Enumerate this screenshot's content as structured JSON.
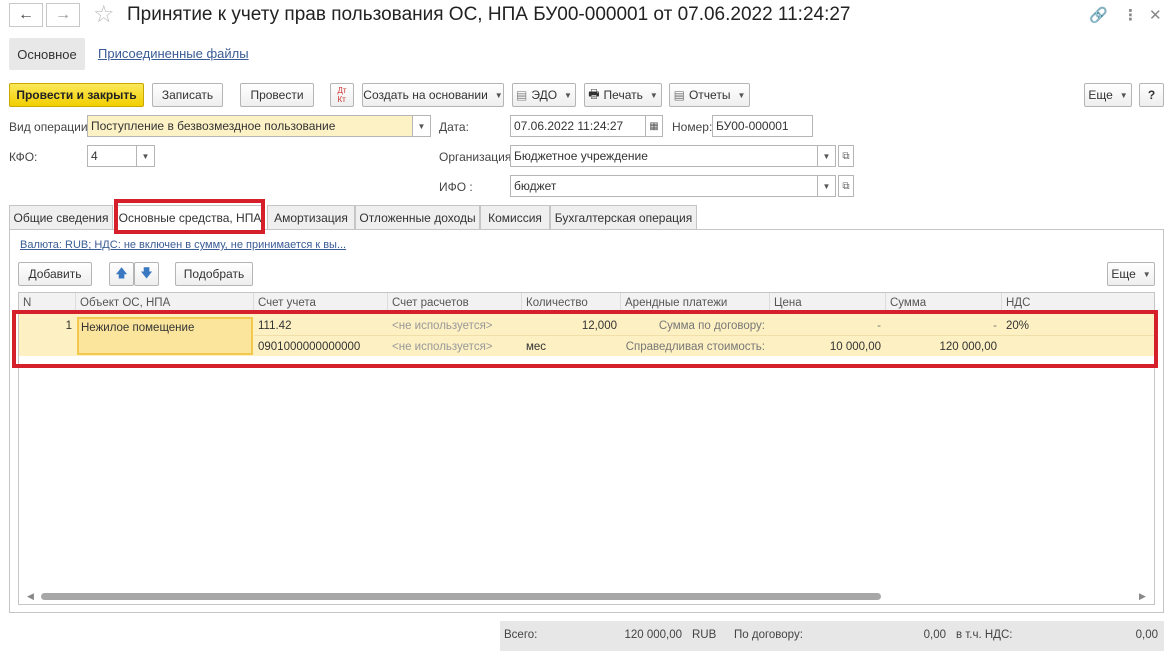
{
  "window": {
    "title": "Принятие к учету прав пользования ОС, НПА БУ00-000001 от 07.06.2022 11:24:27"
  },
  "nav": {
    "main": "Основное",
    "files": "Присоединенные файлы"
  },
  "toolbar": {
    "post_close": "Провести и закрыть",
    "save": "Записать",
    "post": "Провести",
    "create_based": "Создать на основании",
    "edo": "ЭДО",
    "print": "Печать",
    "reports": "Отчеты",
    "more": "Еще",
    "help": "?"
  },
  "form": {
    "operation_label": "Вид операции:",
    "operation_value": "Поступление в безвозмездное пользование",
    "date_label": "Дата:",
    "date_value": "07.06.2022 11:24:27",
    "number_label": "Номер:",
    "number_value": "БУ00-000001",
    "kfo_label": "КФО:",
    "kfo_value": "4",
    "org_label": "Организация:",
    "org_value": "Бюджетное учреждение",
    "ifo_label": "ИФО :",
    "ifo_value": "бюджет"
  },
  "tabs": [
    {
      "label": "Общие сведения"
    },
    {
      "label": "Основные средства, НПА"
    },
    {
      "label": "Амортизация"
    },
    {
      "label": "Отложенные доходы"
    },
    {
      "label": "Комиссия"
    },
    {
      "label": "Бухгалтерская операция"
    }
  ],
  "panel": {
    "currency_info": "Валюта: RUB; НДС: не включен в сумму, не принимается к вы...",
    "add": "Добавить",
    "select": "Подобрать",
    "more": "Еще"
  },
  "table": {
    "columns": [
      "N",
      "Объект ОС, НПА",
      "Счет учета",
      "Счет расчетов",
      "Количество",
      "Арендные платежи",
      "Цена",
      "Сумма",
      "НДС"
    ],
    "row": {
      "n": "1",
      "object": "Нежилое помещение",
      "account": "111.42",
      "account2": "0901000000000000",
      "settlement": "<не используется>",
      "settlement2": "<не используется>",
      "quantity": "12,000",
      "unit": "мес",
      "lease1": "Сумма по договору:",
      "lease2": "Справедливая стоимость:",
      "price1": "-",
      "price2": "10 000,00",
      "sum1": "-",
      "sum2": "120 000,00",
      "vat": "20%"
    }
  },
  "footer": {
    "total_label": "Всего:",
    "total_value": "120 000,00",
    "currency": "RUB",
    "contract_label": "По договору:",
    "contract_value": "0,00",
    "vat_label": "в т.ч. НДС:",
    "vat_value": "0,00"
  }
}
